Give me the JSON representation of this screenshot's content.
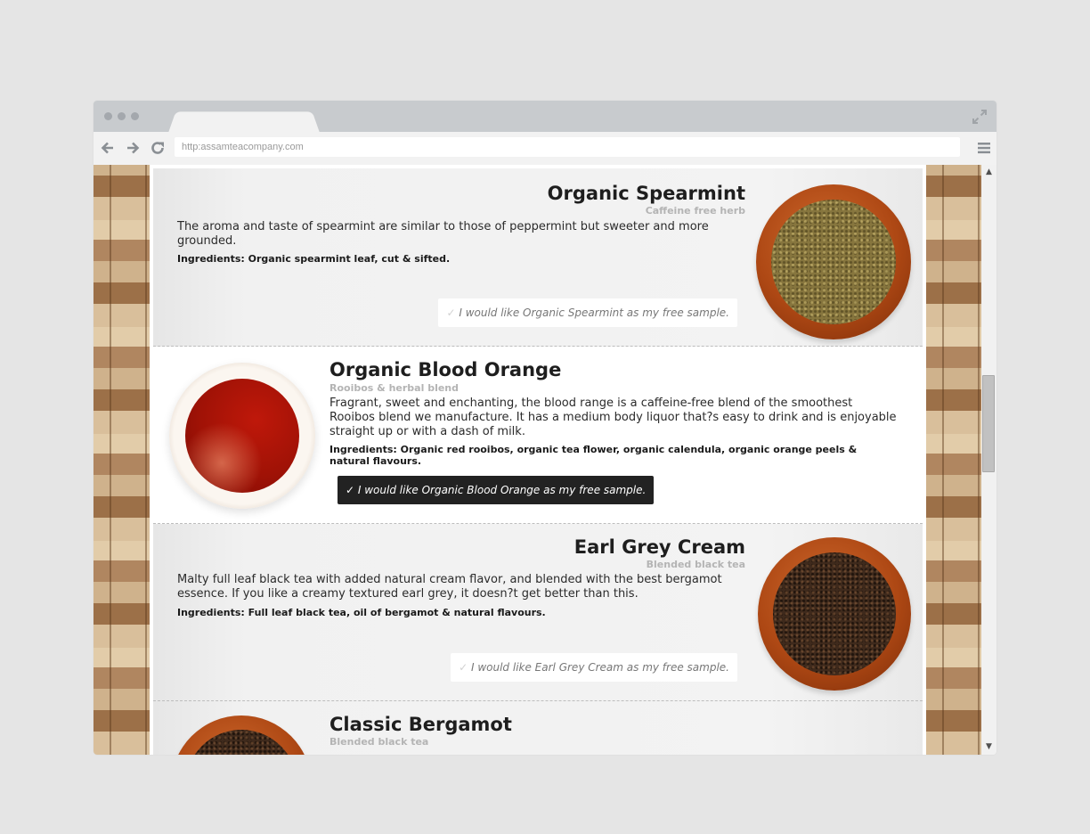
{
  "browser": {
    "url": "http:assamteacompany.com"
  },
  "icons": {
    "back": "arrow-left-icon",
    "forward": "arrow-right-icon",
    "reload": "reload-icon",
    "menu": "hamburger-menu-icon",
    "expand": "expand-icon"
  },
  "products": [
    {
      "name": "Organic Spearmint",
      "category": "Caffeine free herb",
      "description": "The aroma and taste of spearmint are similar to those of peppermint but sweeter and more grounded.",
      "ingredients": "Ingredients: Organic spearmint leaf, cut & sifted.",
      "sample_label": "I would like Organic Spearmint as my free sample.",
      "selected": false
    },
    {
      "name": "Organic Blood Orange",
      "category": "Rooibos & herbal blend",
      "description": "Fragrant, sweet and enchanting, the blood range is a caffeine-free blend of the smoothest Rooibos blend we manufacture. It has a medium body liquor that?s easy to drink and is enjoyable straight up or with a dash of milk.",
      "ingredients": "Ingredients: Organic red rooibos, organic tea flower, organic calendula, organic orange peels & natural flavours.",
      "sample_label": "I would like Organic Blood Orange as my free sample.",
      "selected": true
    },
    {
      "name": "Earl Grey Cream",
      "category": "Blended black tea",
      "description": "Malty full leaf black tea with added natural cream flavor, and blended with the best bergamot essence. If you like a creamy textured earl grey, it doesn?t get better than this.",
      "ingredients": "Ingredients: Full leaf black tea, oil of bergamot & natural flavours.",
      "sample_label": "I would like Earl Grey Cream as my free sample.",
      "selected": false
    },
    {
      "name": "Classic Bergamot",
      "category": "Blended black tea"
    }
  ],
  "check_mark": "✓",
  "colors": {
    "selected_button": "#222222",
    "accent_text": "#1e1e1e",
    "category_text": "#b4b4b4"
  }
}
